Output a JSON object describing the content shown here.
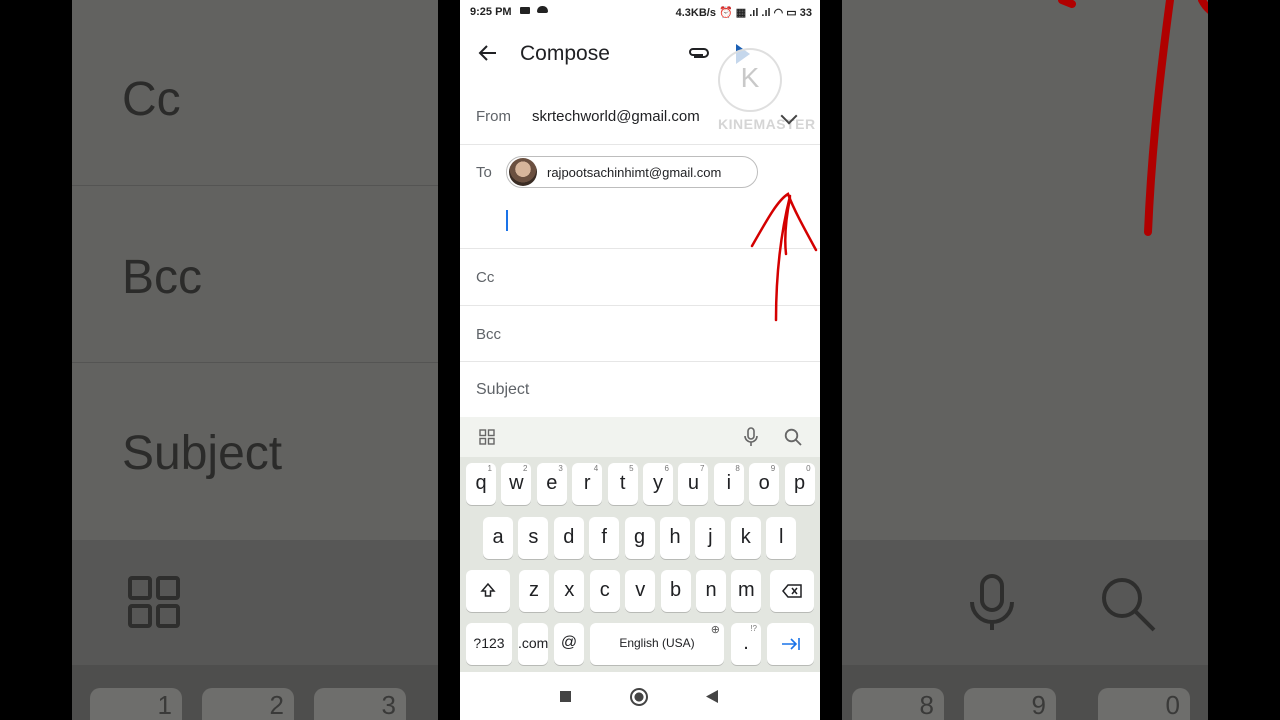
{
  "background": {
    "cc_label": "Cc",
    "bcc_label": "Bcc",
    "subject_label": "Subject",
    "keys": [
      "1",
      "2",
      "3",
      "8",
      "9",
      "0"
    ]
  },
  "status_bar": {
    "time": "9:25 PM",
    "speed_battery": "4.3KB/s ⏰ ▦ .ıl .ıl ◠ ▭ 33"
  },
  "app_bar": {
    "title": "Compose",
    "watermark_letter": "K",
    "watermark_text": "KINEMASTER"
  },
  "from": {
    "label": "From",
    "value": "skrtechworld@gmail.com"
  },
  "to": {
    "label": "To",
    "recipient": "rajpootsachinhimt@gmail.com"
  },
  "cc": {
    "label": "Cc"
  },
  "bcc": {
    "label": "Bcc"
  },
  "subject": {
    "placeholder": "Subject"
  },
  "keyboard": {
    "row1": [
      {
        "k": "q",
        "n": "1"
      },
      {
        "k": "w",
        "n": "2"
      },
      {
        "k": "e",
        "n": "3"
      },
      {
        "k": "r",
        "n": "4"
      },
      {
        "k": "t",
        "n": "5"
      },
      {
        "k": "y",
        "n": "6"
      },
      {
        "k": "u",
        "n": "7"
      },
      {
        "k": "i",
        "n": "8"
      },
      {
        "k": "o",
        "n": "9"
      },
      {
        "k": "p",
        "n": "0"
      }
    ],
    "row2": [
      "a",
      "s",
      "d",
      "f",
      "g",
      "h",
      "j",
      "k",
      "l"
    ],
    "row3": [
      "z",
      "x",
      "c",
      "v",
      "b",
      "n",
      "m"
    ],
    "symbols_label": "?123",
    "com_label": ".com",
    "at_label": "@",
    "space_label": "English (USA)",
    "period_label": ".",
    "period_alt": "!?"
  },
  "colors": {
    "accent": "#1a73e8",
    "annotation": "#d40000"
  }
}
